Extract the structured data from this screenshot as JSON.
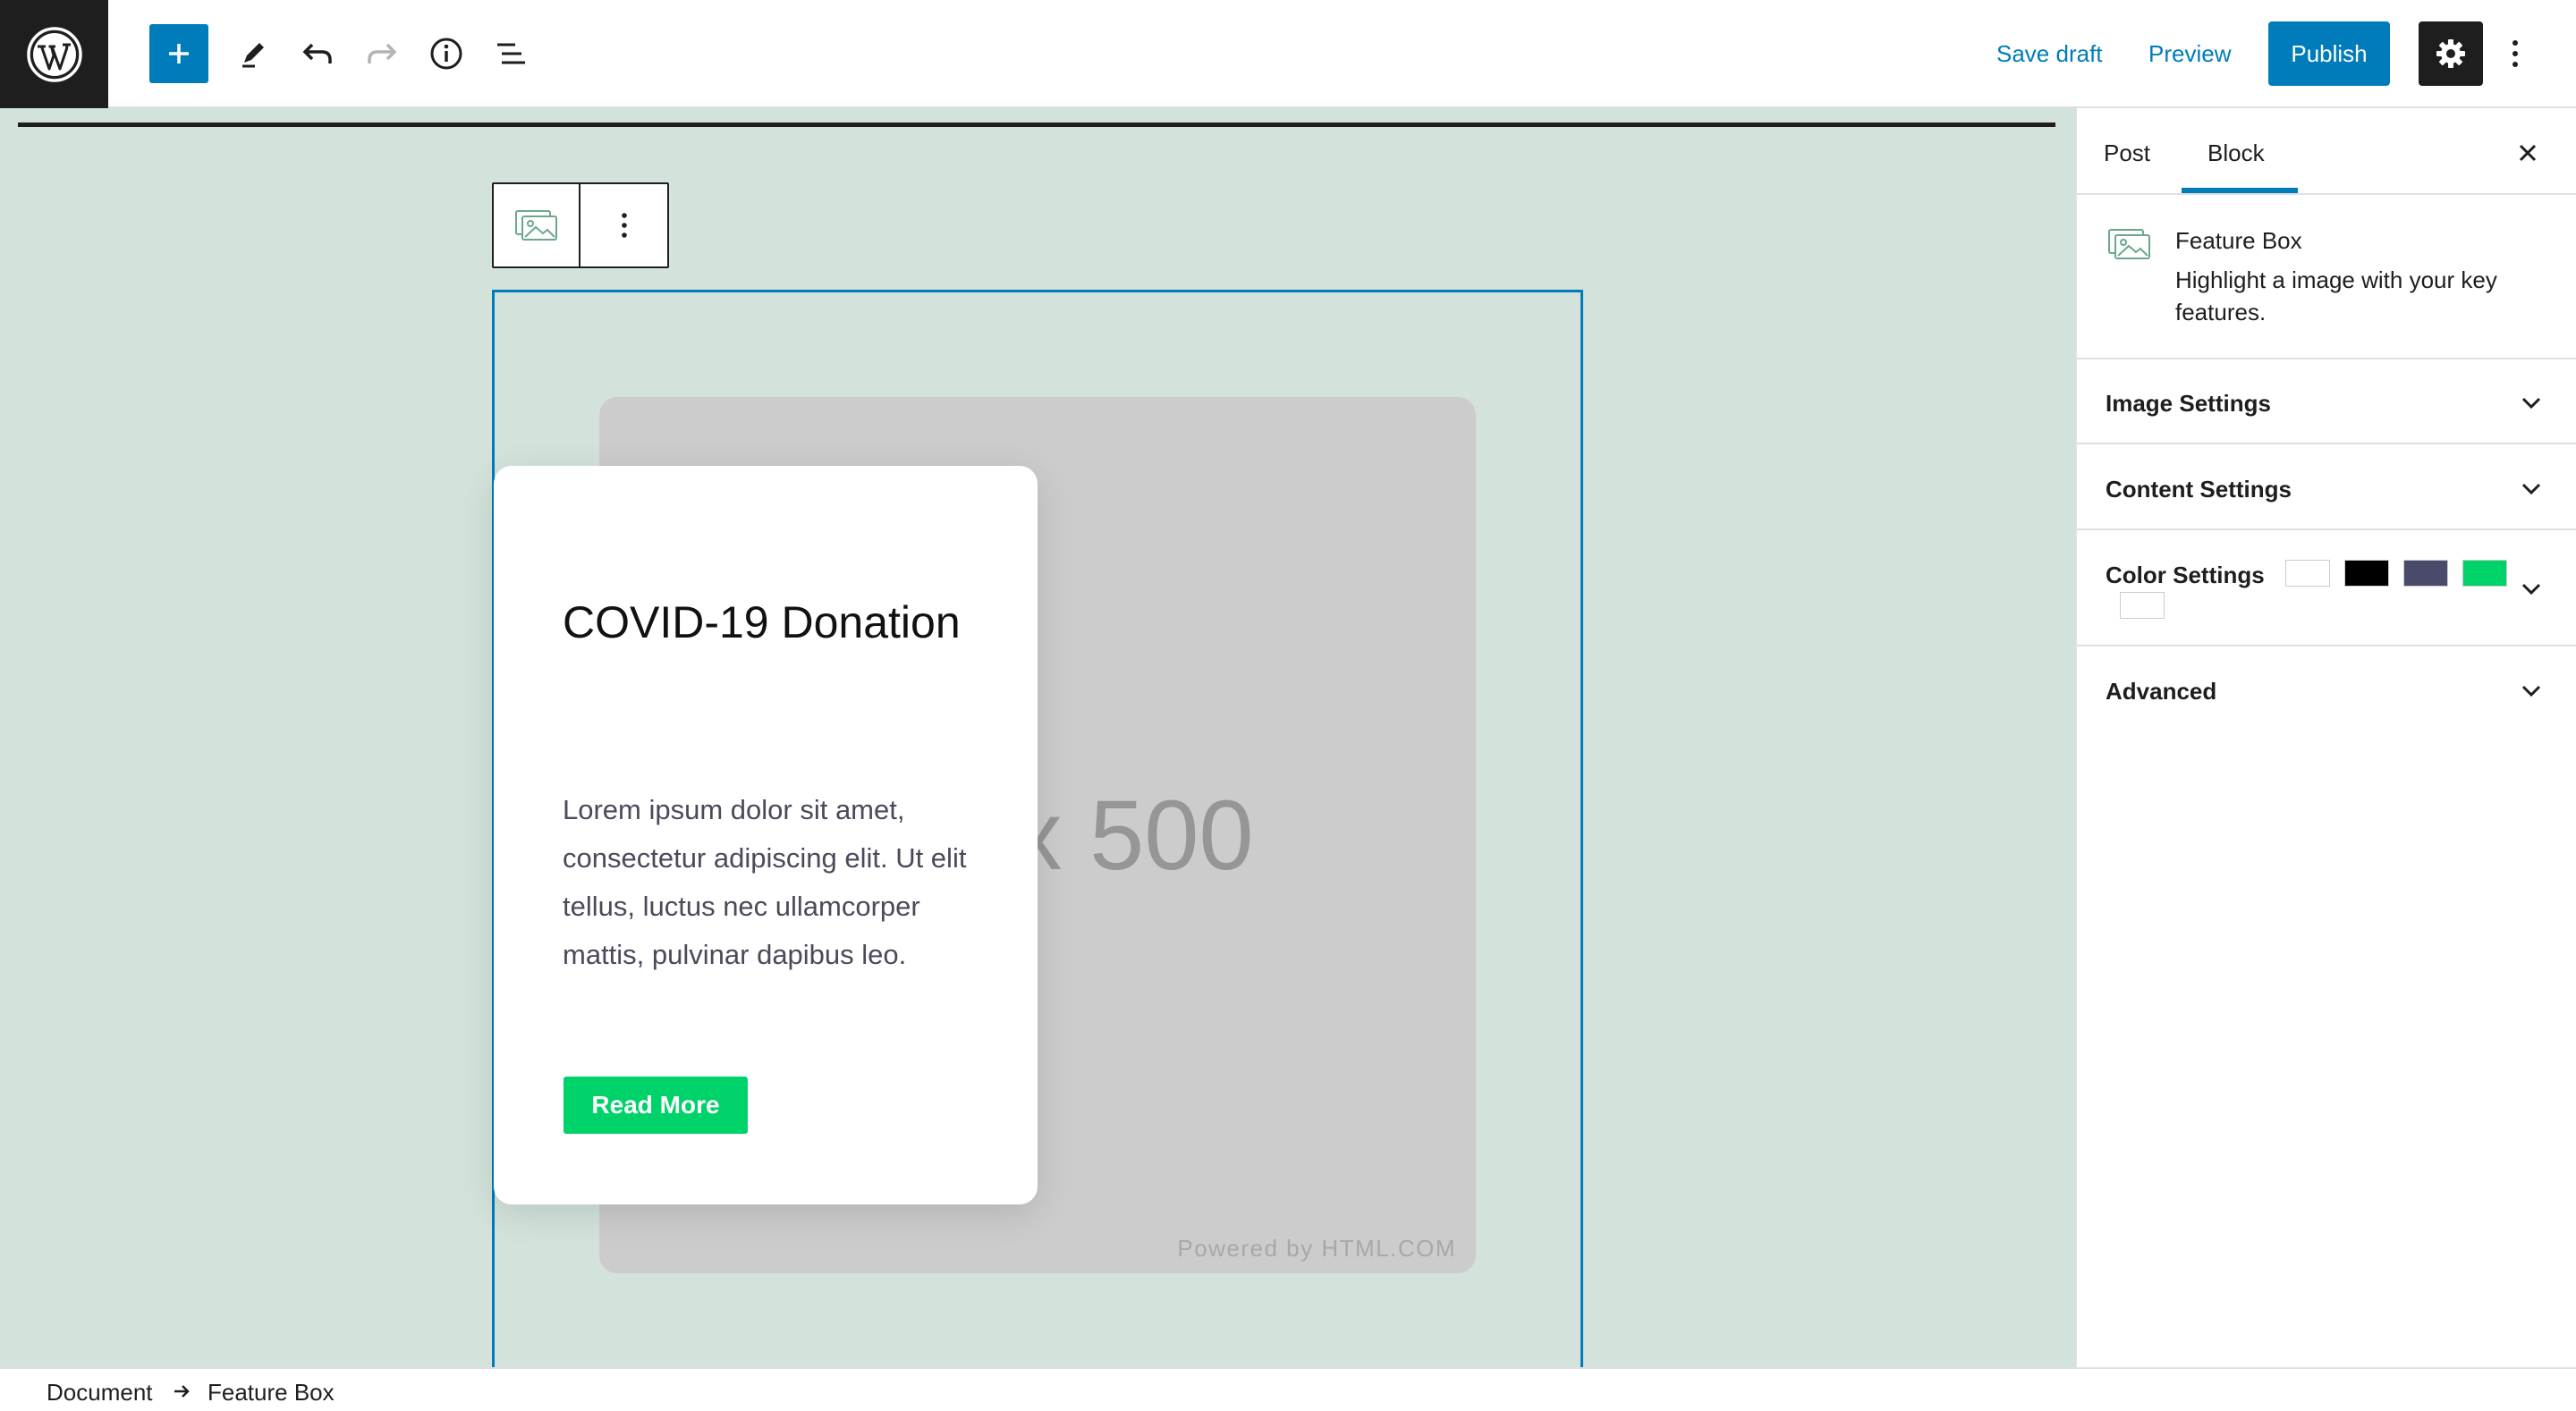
{
  "toolbar": {
    "save_draft": "Save draft",
    "preview": "Preview",
    "publish": "Publish"
  },
  "editor": {
    "block_toolbar_icon": "image-placeholder-icon",
    "card": {
      "title": "COVID-19 Donation",
      "body": "Lorem ipsum dolor sit amet, consectetur adipiscing elit. Ut elit tellus, luctus nec ullamcorper mattis, pulvinar dapibus leo.",
      "button_label": "Read More"
    },
    "placeholder": {
      "size_text": "500 x 500",
      "credit": "Powered by HTML.COM"
    }
  },
  "sidebar": {
    "tabs": [
      {
        "label": "Post",
        "active": false
      },
      {
        "label": "Block",
        "active": true
      }
    ],
    "block_card": {
      "title": "Feature Box",
      "description": "Highlight a image with your key features."
    },
    "panels": [
      {
        "label": "Image Settings"
      },
      {
        "label": "Content Settings"
      },
      {
        "label": "Color Settings"
      },
      {
        "label": "Advanced"
      }
    ],
    "color_swatches": [
      "#ffffff",
      "#000000",
      "#4a4a6a",
      "#00d26a",
      "#ffffff"
    ]
  },
  "breadcrumb": {
    "items": [
      "Document",
      "Feature Box"
    ]
  },
  "colors": {
    "accent": "#007cba",
    "canvas_bg": "#d3e3dc",
    "button_green": "#00d26a",
    "dark": "#1e1e1e"
  }
}
